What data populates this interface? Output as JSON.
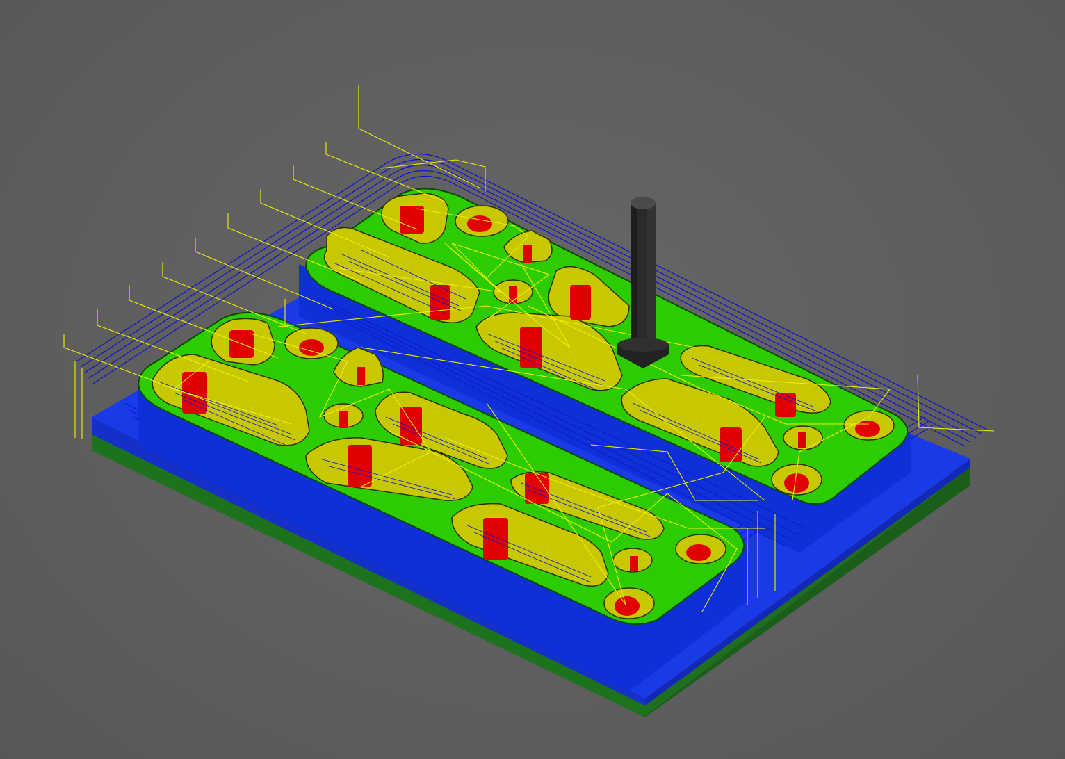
{
  "scene": {
    "description_shown": false,
    "colors": {
      "background": "#5f5f5f",
      "stock_base": "#1f7a1f",
      "stock_rough": "#1a3cf0",
      "part_top": "#22cc00",
      "pocket_wall": "#c8c800",
      "hole_cut": "#e00000",
      "toolpath_cut": "#1010c8",
      "toolpath_rapid": "#f0f000",
      "tool": "#2a2a2a"
    },
    "icons": [
      "end-mill-tool-icon"
    ]
  }
}
